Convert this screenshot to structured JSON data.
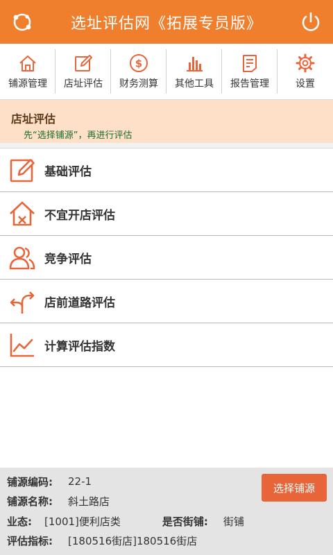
{
  "header": {
    "title": "选址评估网《拓展专员版》"
  },
  "toolbar": {
    "items": [
      {
        "label": "铺源管理",
        "icon": "home-icon"
      },
      {
        "label": "店址评估",
        "icon": "edit-icon"
      },
      {
        "label": "财务测算",
        "icon": "dollar-icon"
      },
      {
        "label": "其他工具",
        "icon": "bar-chart-icon"
      },
      {
        "label": "报告管理",
        "icon": "report-icon"
      },
      {
        "label": "设置",
        "icon": "gear-icon"
      }
    ]
  },
  "section": {
    "title": "店址评估",
    "subtitle": "先“选择铺源”，再进行评估"
  },
  "menu": {
    "items": [
      {
        "label": "基础评估",
        "icon": "edit-icon"
      },
      {
        "label": "不宜开店评估",
        "icon": "house-x-icon"
      },
      {
        "label": "竞争评估",
        "icon": "users-icon"
      },
      {
        "label": "店前道路评估",
        "icon": "road-split-icon"
      },
      {
        "label": "计算评估指数",
        "icon": "line-chart-icon"
      }
    ]
  },
  "footer": {
    "code_label": "铺源编码:",
    "code_value": "22-1",
    "name_label": "铺源名称:",
    "name_value": "斜土路店",
    "type_label": "业态:",
    "type_value": "[1001]便利店类",
    "street_label": "是否街铺:",
    "street_value": "街铺",
    "index_label": "评估指标:",
    "index_value": "[180516街店]180516街店",
    "select_button": "选择铺源"
  },
  "colors": {
    "header_bg": "#f07f2d",
    "icon_accent": "#e8653a",
    "section_bg": "#fde0c7",
    "subtitle_green": "#1e6b2a",
    "footer_bg": "#e4e4e4"
  }
}
